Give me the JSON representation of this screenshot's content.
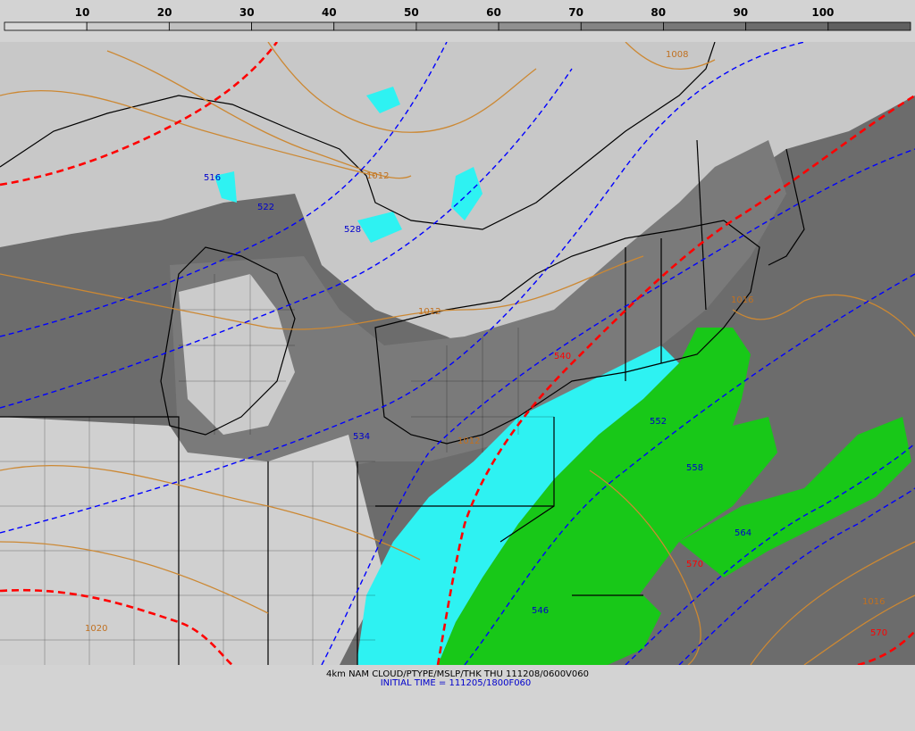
{
  "colorbar": {
    "ticks": [
      "10",
      "20",
      "30",
      "40",
      "50",
      "60",
      "70",
      "80",
      "90",
      "100"
    ],
    "colors": [
      "#d8d8d8",
      "#cccccc",
      "#c0c0c0",
      "#b4b4b4",
      "#a8a8a8",
      "#9c9c9c",
      "#909090",
      "#848484",
      "#787878",
      "#6c6c6c",
      "#606060"
    ]
  },
  "map": {
    "colors": {
      "ocean": "#6c6c6c",
      "cloud_light": "#c8c8c8",
      "cloud_mid": "#9a9a9a",
      "snow": "#2ef2f2",
      "rain": "#18c818",
      "rain_dark": "#00a000",
      "thickness_540": "#ff0000",
      "thickness_other": "#0000ff",
      "isobar": "#cc8833",
      "borders": "#000000"
    },
    "labels": {
      "thickness": [
        "516",
        "522",
        "528",
        "534",
        "540",
        "546",
        "552",
        "558",
        "564",
        "570",
        "570"
      ],
      "isobars": [
        "1012",
        "1008",
        "1012",
        "1016",
        "1016",
        "1012",
        "1020"
      ]
    }
  },
  "footer": {
    "line1": "4km NAM CLOUD/PTYPE/MSLP/THK THU 111208/0600V060",
    "line2": "INITIAL TIME = 111205/1800F060"
  }
}
